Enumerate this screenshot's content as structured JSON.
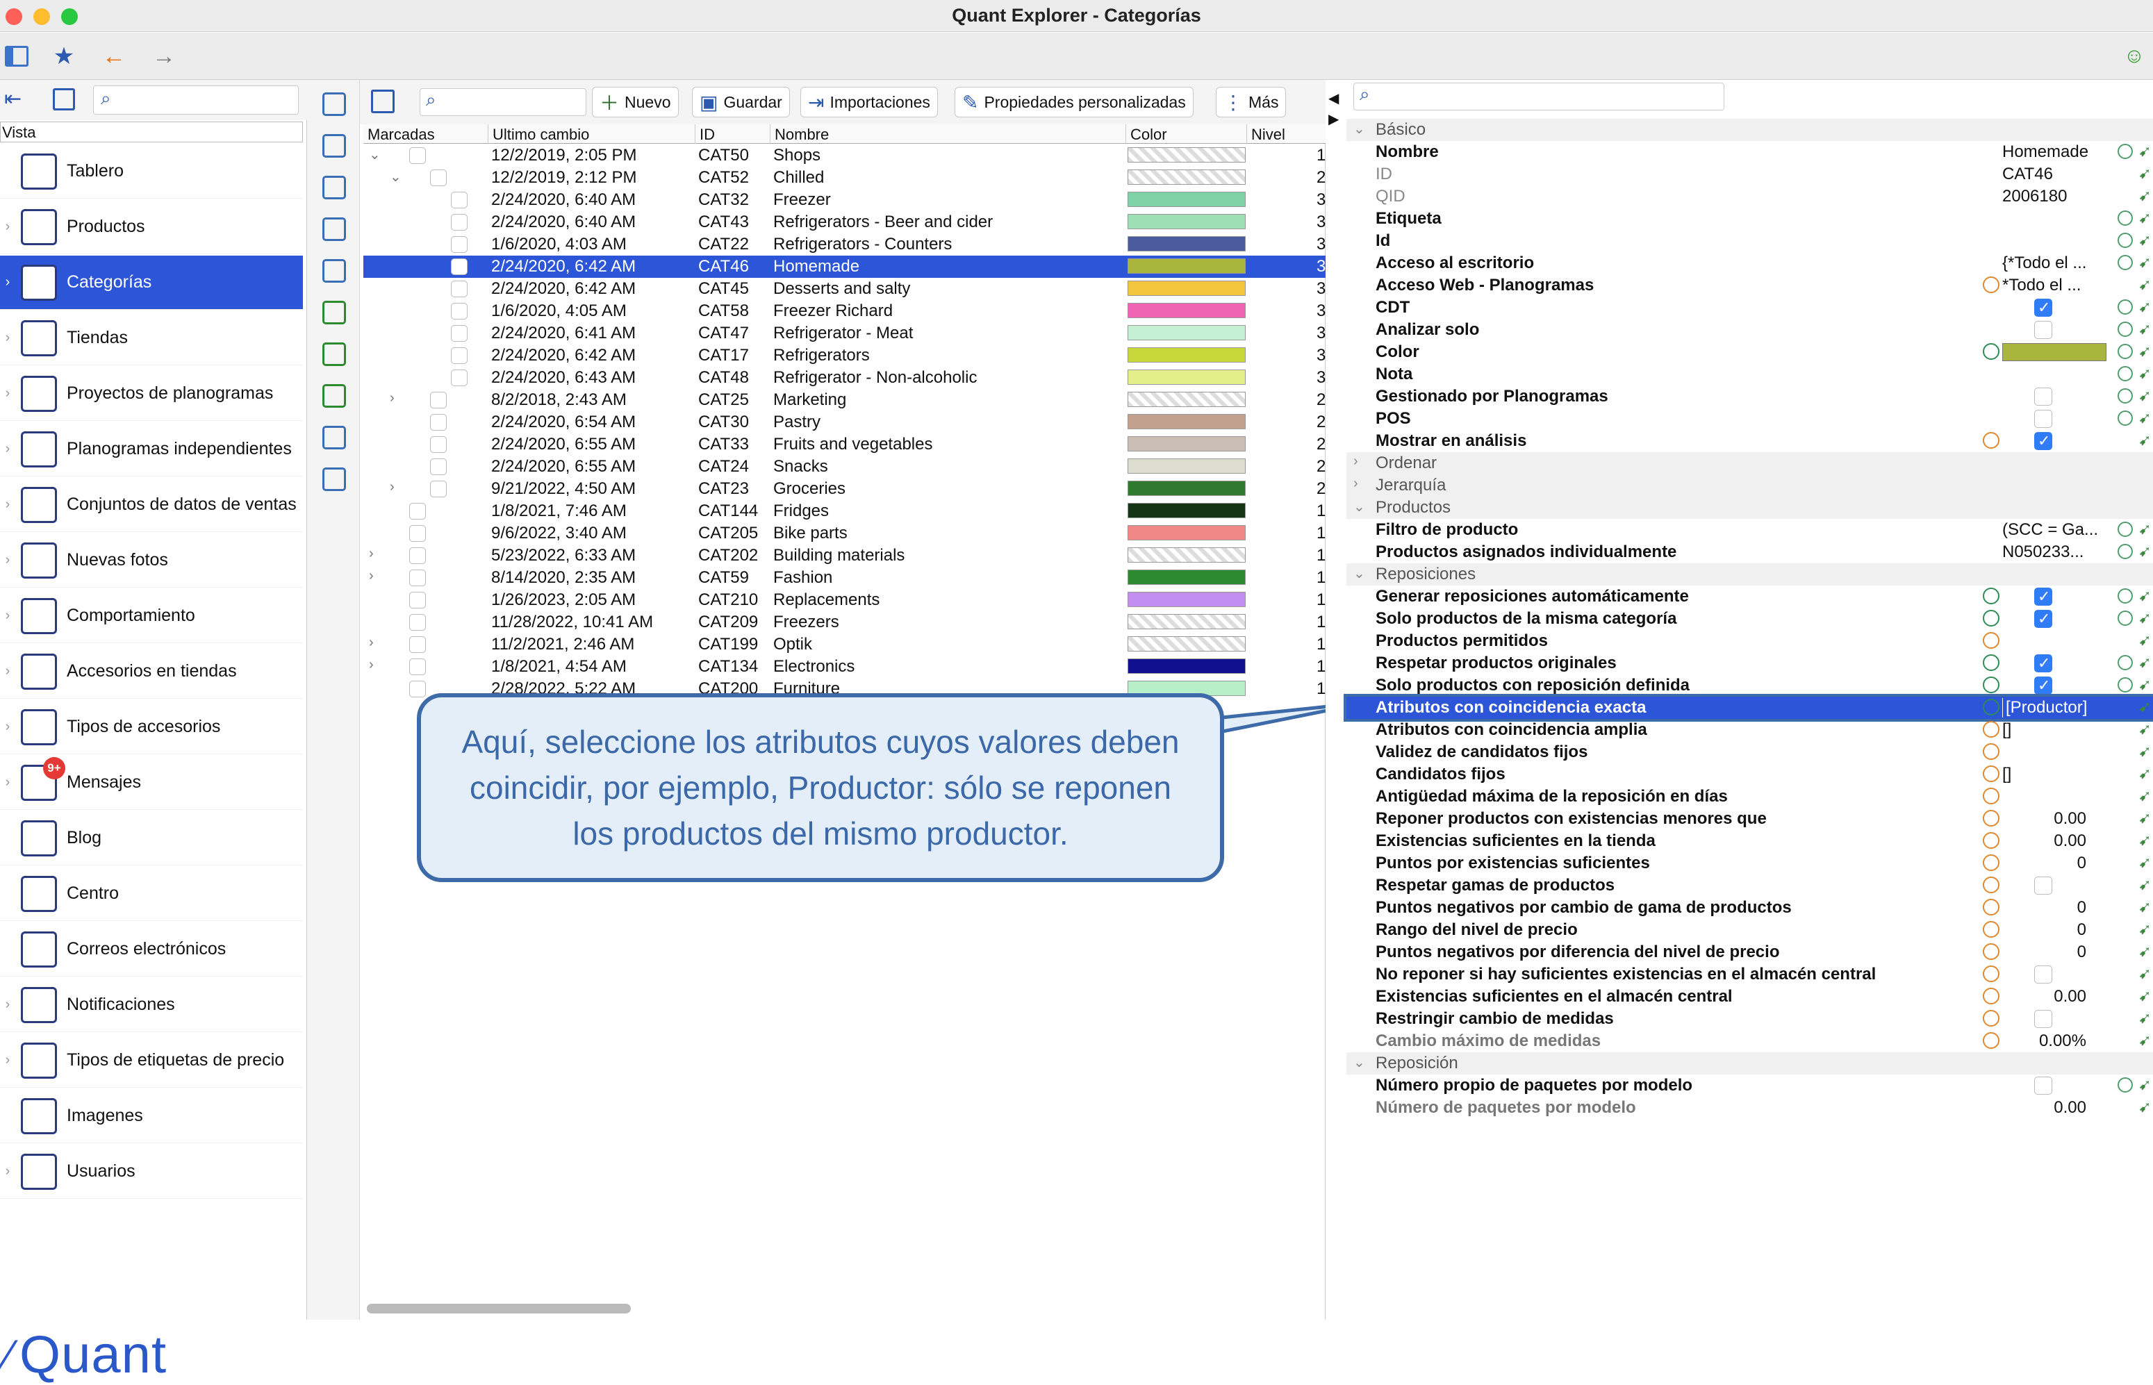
{
  "window": {
    "title": "Quant Explorer - Categorías"
  },
  "sidebar": {
    "vista_label": "Vista",
    "items": [
      {
        "label": "Tablero"
      },
      {
        "label": "Productos"
      },
      {
        "label": "Categorías"
      },
      {
        "label": "Tiendas"
      },
      {
        "label": "Proyectos de planogramas"
      },
      {
        "label": "Planogramas independientes"
      },
      {
        "label": "Conjuntos de datos de ventas"
      },
      {
        "label": "Nuevas fotos"
      },
      {
        "label": "Comportamiento"
      },
      {
        "label": "Accesorios en tiendas"
      },
      {
        "label": "Tipos de accesorios"
      },
      {
        "label": "Mensajes"
      },
      {
        "label": "Blog"
      },
      {
        "label": "Centro"
      },
      {
        "label": "Correos electrónicos"
      },
      {
        "label": "Notificaciones"
      },
      {
        "label": "Tipos de etiquetas de precio"
      },
      {
        "label": "Imagenes"
      },
      {
        "label": "Usuarios"
      }
    ],
    "messages_badge": "9+",
    "logo_text": "Quant"
  },
  "center": {
    "toolbar": {
      "new": "Nuevo",
      "save": "Guardar",
      "imports": "Importaciones",
      "custom_props": "Propiedades personalizadas",
      "more": "Más"
    },
    "columns": [
      "Marcadas",
      "Ultimo cambio",
      "ID",
      "Nombre",
      "Color",
      "Nivel"
    ],
    "rows": [
      {
        "changed": "12/2/2019, 2:05 PM",
        "id": "CAT50",
        "name": "Shops",
        "color": "#ffffff",
        "level": "1"
      },
      {
        "changed": "12/2/2019, 2:12 PM",
        "id": "CAT52",
        "name": "Chilled",
        "color": "#ffffff",
        "level": "2"
      },
      {
        "changed": "2/24/2020, 6:40 AM",
        "id": "CAT32",
        "name": "Freezer",
        "color": "#7fd1a6",
        "level": "3"
      },
      {
        "changed": "2/24/2020, 6:40 AM",
        "id": "CAT43",
        "name": "Refrigerators - Beer and cider",
        "color": "#9ee0b6",
        "level": "3"
      },
      {
        "changed": "1/6/2020, 4:03 AM",
        "id": "CAT22",
        "name": "Refrigerators - Counters",
        "color": "#4a5a9a",
        "level": "3"
      },
      {
        "changed": "2/24/2020, 6:42 AM",
        "id": "CAT46",
        "name": "Homemade",
        "color": "#a9b53d",
        "level": "3"
      },
      {
        "changed": "2/24/2020, 6:42 AM",
        "id": "CAT45",
        "name": "Desserts and salty",
        "color": "#f2c53d",
        "level": "3"
      },
      {
        "changed": "1/6/2020, 4:05 AM",
        "id": "CAT58",
        "name": "Freezer Richard",
        "color": "#f062b3",
        "level": "3"
      },
      {
        "changed": "2/24/2020, 6:41 AM",
        "id": "CAT47",
        "name": "Refrigerator - Meat",
        "color": "#c5f0d4",
        "level": "3"
      },
      {
        "changed": "2/24/2020, 6:42 AM",
        "id": "CAT17",
        "name": "Refrigerators",
        "color": "#c8d83a",
        "level": "3"
      },
      {
        "changed": "2/24/2020, 6:43 AM",
        "id": "CAT48",
        "name": "Refrigerator - Non-alcoholic",
        "color": "#e2ef8a",
        "level": "3"
      },
      {
        "changed": "8/2/2018, 2:43 AM",
        "id": "CAT25",
        "name": "Marketing",
        "color": "#ffffff",
        "level": "2"
      },
      {
        "changed": "2/24/2020, 6:54 AM",
        "id": "CAT30",
        "name": "Pastry",
        "color": "#c2a28e",
        "level": "2"
      },
      {
        "changed": "2/24/2020, 6:55 AM",
        "id": "CAT33",
        "name": "Fruits and vegetables",
        "color": "#c9beb4",
        "level": "2"
      },
      {
        "changed": "2/24/2020, 6:55 AM",
        "id": "CAT24",
        "name": "Snacks",
        "color": "#dcdcd0",
        "level": "2"
      },
      {
        "changed": "9/21/2022, 4:50 AM",
        "id": "CAT23",
        "name": "Groceries",
        "color": "#2f7a2f",
        "level": "2"
      },
      {
        "changed": "1/8/2021, 7:46 AM",
        "id": "CAT144",
        "name": "Fridges",
        "color": "#143414",
        "level": "1"
      },
      {
        "changed": "9/6/2022, 3:40 AM",
        "id": "CAT205",
        "name": "Bike parts",
        "color": "#f08888",
        "level": "1"
      },
      {
        "changed": "5/23/2022, 6:33 AM",
        "id": "CAT202",
        "name": "Building materials",
        "color": "#ffffff",
        "level": "1"
      },
      {
        "changed": "8/14/2020, 2:35 AM",
        "id": "CAT59",
        "name": "Fashion",
        "color": "#2e8a2e",
        "level": "1"
      },
      {
        "changed": "1/26/2023, 2:05 AM",
        "id": "CAT210",
        "name": "Replacements",
        "color": "#c18ef0",
        "level": "1"
      },
      {
        "changed": "11/28/2022, 10:41 AM",
        "id": "CAT209",
        "name": "Freezers",
        "color": "#ffffff",
        "level": "1"
      },
      {
        "changed": "11/2/2021, 2:46 AM",
        "id": "CAT199",
        "name": "Optik",
        "color": "#ffffff",
        "level": "1"
      },
      {
        "changed": "1/8/2021, 4:54 AM",
        "id": "CAT134",
        "name": "Electronics",
        "color": "#101090",
        "level": "1"
      },
      {
        "changed": "2/28/2022, 5:22 AM",
        "id": "CAT200",
        "name": "Furniture",
        "color": "#b8efc8",
        "level": "1"
      }
    ]
  },
  "callout": {
    "text": "Aquí, seleccione los atributos cuyos valores deben coincidir, por ejemplo, Productor: sólo se reponen los productos del mismo productor."
  },
  "properties": {
    "groups": {
      "basico": "Básico",
      "ordenar": "Ordenar",
      "jerarquia": "Jerarquía",
      "productos": "Productos",
      "reposiciones": "Reposiciones",
      "reposicion": "Reposición"
    },
    "rows": {
      "nombre": {
        "label": "Nombre",
        "value": "Homemade"
      },
      "id": {
        "label": "ID",
        "value": "CAT46"
      },
      "qid": {
        "label": "QID",
        "value": "2006180"
      },
      "etiqueta": {
        "label": "Etiqueta"
      },
      "id2": {
        "label": "Id"
      },
      "acceso_escritorio": {
        "label": "Acceso al escritorio",
        "value": "{*Todo el ..."
      },
      "acceso_web": {
        "label": "Acceso Web - Planogramas",
        "value": "*Todo el ..."
      },
      "cdt": {
        "label": "CDT"
      },
      "analizar": {
        "label": "Analizar solo"
      },
      "color": {
        "label": "Color",
        "value": "#a9b53d"
      },
      "nota": {
        "label": "Nota"
      },
      "gestionado": {
        "label": "Gestionado por Planogramas"
      },
      "pos": {
        "label": "POS"
      },
      "mostrar": {
        "label": "Mostrar en análisis"
      },
      "filtro": {
        "label": "Filtro de producto",
        "value": "(SCC = Ga..."
      },
      "asignados": {
        "label": "Productos asignados individualmente",
        "value": "N050233..."
      },
      "generar": {
        "label": "Generar reposiciones automáticamente"
      },
      "solo_misma": {
        "label": "Solo productos de la misma categoría"
      },
      "permitidos": {
        "label": "Productos permitidos"
      },
      "respetar_orig": {
        "label": "Respetar productos originales"
      },
      "solo_repos": {
        "label": "Solo productos con reposición definida"
      },
      "exacta": {
        "label": "Atributos con coincidencia exacta",
        "value": "[Productor]"
      },
      "amplia": {
        "label": "Atributos con coincidencia amplia",
        "value": "[]"
      },
      "validez": {
        "label": "Validez de candidatos fijos"
      },
      "candidatos": {
        "label": "Candidatos fijos",
        "value": "[]"
      },
      "antiguedad": {
        "label": "Antigüedad máxima de la reposición en días"
      },
      "reponer_menores": {
        "label": "Reponer productos con existencias menores que",
        "value": "0.00"
      },
      "suf_tienda": {
        "label": "Existencias suficientes en la tienda",
        "value": "0.00"
      },
      "puntos_suf": {
        "label": "Puntos por existencias suficientes",
        "value": "0"
      },
      "respetar_gamas": {
        "label": "Respetar gamas de productos"
      },
      "neg_gama": {
        "label": "Puntos negativos por cambio de gama de productos",
        "value": "0"
      },
      "rango_precio": {
        "label": "Rango del nivel de precio",
        "value": "0"
      },
      "neg_precio": {
        "label": "Puntos negativos por diferencia del nivel de precio",
        "value": "0"
      },
      "no_reponer": {
        "label": "No reponer si hay suficientes existencias en el almacén central"
      },
      "suf_central": {
        "label": "Existencias suficientes en el almacén central",
        "value": "0.00"
      },
      "restringir": {
        "label": "Restringir cambio de medidas"
      },
      "cambio_max": {
        "label": "Cambio máximo de medidas",
        "value": "0.00%"
      },
      "num_propio": {
        "label": "Número propio de paquetes por modelo"
      },
      "num_paquetes": {
        "label": "Número de paquetes por modelo",
        "value": "0.00"
      }
    }
  }
}
